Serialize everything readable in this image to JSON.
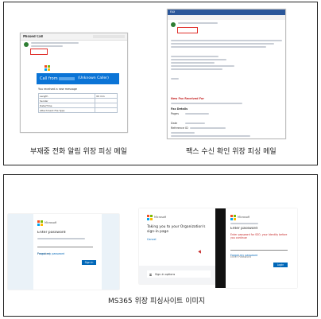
{
  "captions": {
    "missed_call": "부재중 전화 알림 위장 피싱 메일",
    "fax": "팩스 수신 확인 위장 피싱 메일",
    "ms365": "MS365 위장 피싱사이트 이미지"
  },
  "missed_call_mail": {
    "subject": "Missed Call",
    "banner_title": "Call from",
    "banner_caller": "(Unknown Caller)",
    "intro": "You received a new message",
    "rows": [
      [
        "Length",
        "00 min"
      ],
      [
        "Sender",
        ""
      ],
      [
        "Date/Time",
        ""
      ],
      [
        "Attachment File Type",
        ""
      ]
    ]
  },
  "fax_mail": {
    "title_bar": "FAX",
    "new_fax": "New Fax Received For",
    "fax_details": "Fax Details",
    "pages": "Pages",
    "date": "Date",
    "reference": "Reference ID"
  },
  "ms365_left": {
    "brand": "Microsoft",
    "heading": "Enter password",
    "field_placeholder": "Password",
    "forgot": "Forgot my password",
    "button": "Sign in"
  },
  "ms365_middle": {
    "brand": "Microsoft",
    "heading": "Taking you to your Organization's sign-in page",
    "cancel": "Cancel",
    "signin_options": "Sign-in options"
  },
  "ms365_right": {
    "brand": "Microsoft",
    "heading": "Enter password",
    "error": "Enter password for SSO, your Identity before you continue",
    "field_placeholder": "Enter Password",
    "forgot": "Forgot my password",
    "button": "Login"
  },
  "colors": {
    "ms_blue": "#0067b8",
    "banner_blue": "#0b74d6",
    "red_highlight": "#e0302c"
  }
}
